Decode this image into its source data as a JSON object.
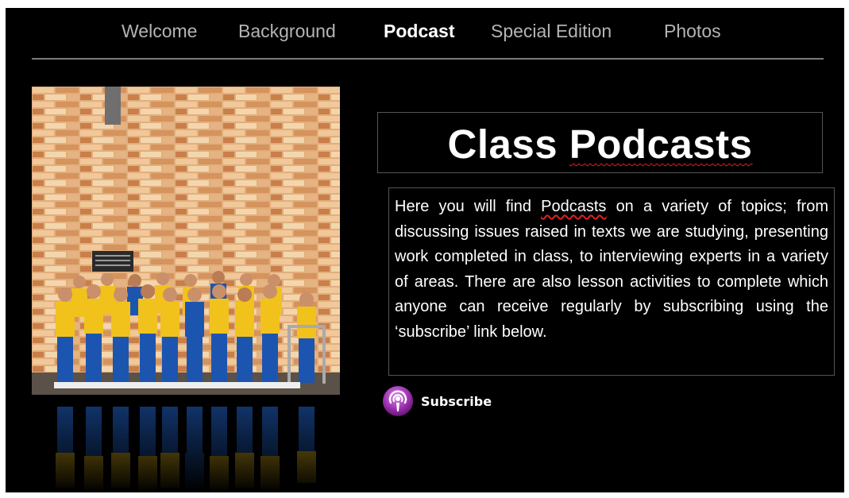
{
  "nav": {
    "items": [
      {
        "label": "Welcome",
        "active": false
      },
      {
        "label": "Background",
        "active": false
      },
      {
        "label": "Podcast",
        "active": true
      },
      {
        "label": "Special Edition",
        "active": false
      },
      {
        "label": "Photos",
        "active": false
      }
    ]
  },
  "main": {
    "title_word1": "Class",
    "title_word2": "Podcasts",
    "body_pre": "Here you will find",
    "body_link_word": "Podcasts",
    "body_post": "on a variety of topics; from discussing issues raised in texts we are studying, presenting work completed in class, to interviewing experts in a variety of areas. There are also lesson activities to complete which anyone can receive regularly by subscribing using the ‘subscribe’ link below.",
    "subscribe_label": "Subscribe",
    "subscribe_icon": "podcast-icon"
  },
  "photo": {
    "icon": "class-photo"
  },
  "colors": {
    "background": "#000000",
    "nav_text": "#b4b4b4",
    "nav_active": "#ffffff",
    "spellcheck": "#e02020",
    "podcast_purple": "#9b2fae"
  }
}
